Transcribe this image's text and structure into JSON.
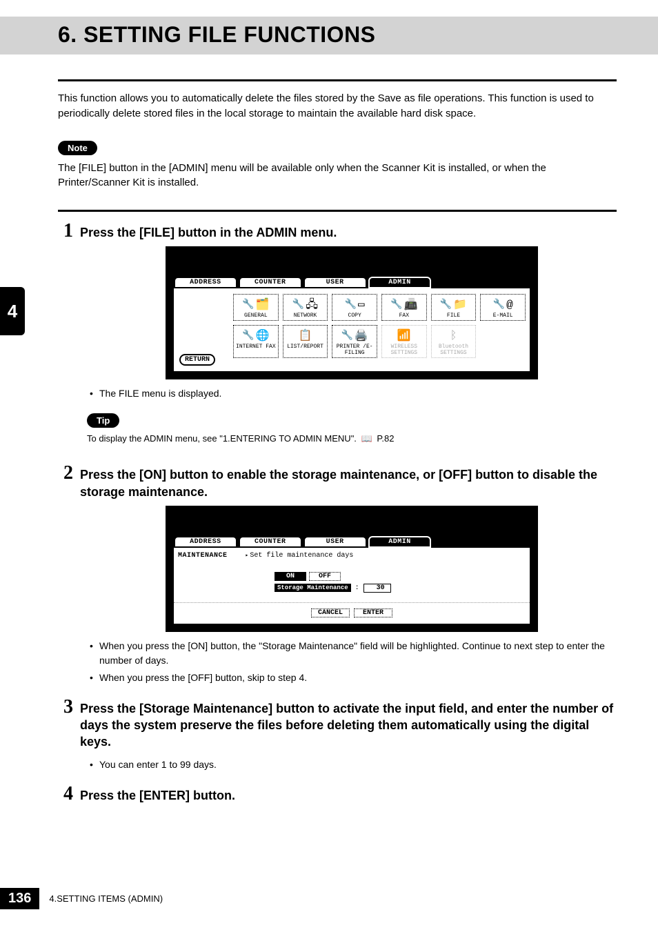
{
  "header": {
    "title": "6. SETTING FILE FUNCTIONS"
  },
  "intro": "This function allows you to automatically delete the files stored by the Save as file operations.  This function is used to periodically delete stored files in the local storage to maintain the available hard disk space.",
  "note": {
    "label": "Note",
    "text": "The [FILE] button in the [ADMIN] menu will be available only when the Scanner Kit is installed, or when the Printer/Scanner Kit is installed."
  },
  "sidebar_chapter": "4",
  "steps": {
    "s1": {
      "num": "1",
      "title": "Press the [FILE] button in the ADMIN menu.",
      "bullet1": "The FILE menu is displayed."
    },
    "tip": {
      "label": "Tip",
      "text_prefix": "To display the ADMIN menu, see \"1.ENTERING TO ADMIN MENU\".",
      "page_ref": "P.82"
    },
    "s2": {
      "num": "2",
      "title": "Press the [ON] button to enable the storage maintenance, or [OFF] button to disable the storage maintenance.",
      "bullet1": "When you press the [ON] button, the \"Storage Maintenance\" field will be highlighted.  Continue to next step to enter the number of days.",
      "bullet2": "When you press the [OFF] button, skip to step 4."
    },
    "s3": {
      "num": "3",
      "title": "Press the [Storage Maintenance] button to activate the input field, and enter the number of days the system preserve the files before deleting them automatically using the digital keys.",
      "bullet1": "You can enter 1 to 99 days."
    },
    "s4": {
      "num": "4",
      "title": "Press the [ENTER] button."
    }
  },
  "lcd1": {
    "tabs": {
      "address": "ADDRESS",
      "counter": "COUNTER",
      "user": "USER",
      "admin": "ADMIN"
    },
    "icons": {
      "general": "GENERAL",
      "network": "NETWORK",
      "copy": "COPY",
      "fax": "FAX",
      "file": "FILE",
      "email": "E-MAIL",
      "internet_fax": "INTERNET FAX",
      "list_report": "LIST/REPORT",
      "printer_efiling": "PRINTER /E-FILING",
      "wireless": "WIRELESS SETTINGS",
      "bluetooth": "Bluetooth SETTINGS"
    },
    "return": "RETURN"
  },
  "lcd2": {
    "tabs": {
      "address": "ADDRESS",
      "counter": "COUNTER",
      "user": "USER",
      "admin": "ADMIN"
    },
    "maintenance_label": "MAINTENANCE",
    "hint": "Set file maintenance days",
    "on": "ON",
    "off": "OFF",
    "storage_label": "Storage Maintenance",
    "storage_colon": ":",
    "storage_value": "30",
    "cancel": "CANCEL",
    "enter": "ENTER"
  },
  "footer": {
    "page_number": "136",
    "section": "4.SETTING ITEMS (ADMIN)"
  }
}
